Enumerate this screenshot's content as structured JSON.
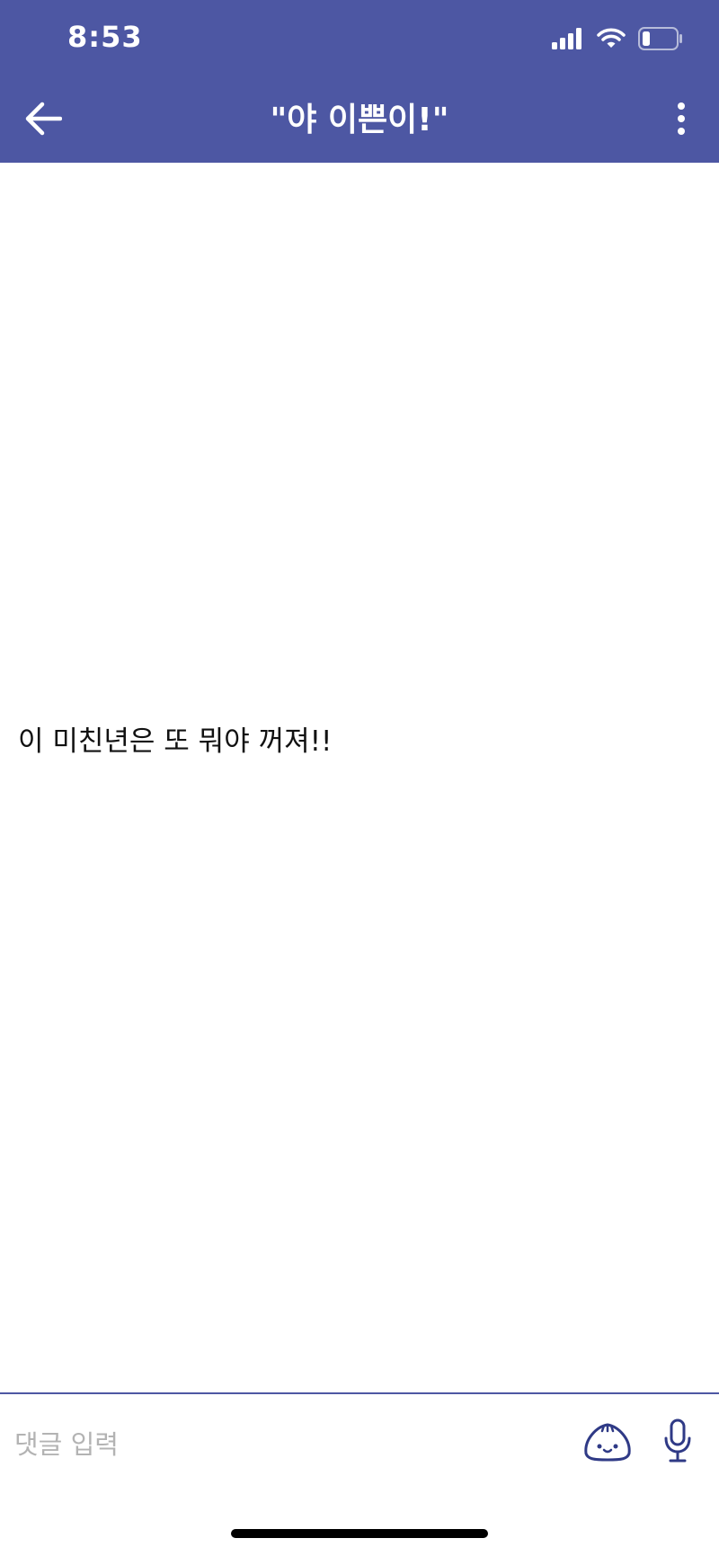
{
  "status_bar": {
    "time": "8:53"
  },
  "navbar": {
    "title": "\"야 이쁜이!\"",
    "back_icon": "arrow-left-icon",
    "more_icon": "vertical-dots-icon"
  },
  "post": {
    "text": "이 미친년은 또 뭐야 꺼져!!"
  },
  "comment_bar": {
    "placeholder": "댓글 입력",
    "emoji_icon": "dumpling-face-icon",
    "mic_icon": "microphone-icon"
  },
  "colors": {
    "header_bg": "#4d57a3",
    "accent": "#2f3a86",
    "placeholder": "#b3b3b3"
  }
}
